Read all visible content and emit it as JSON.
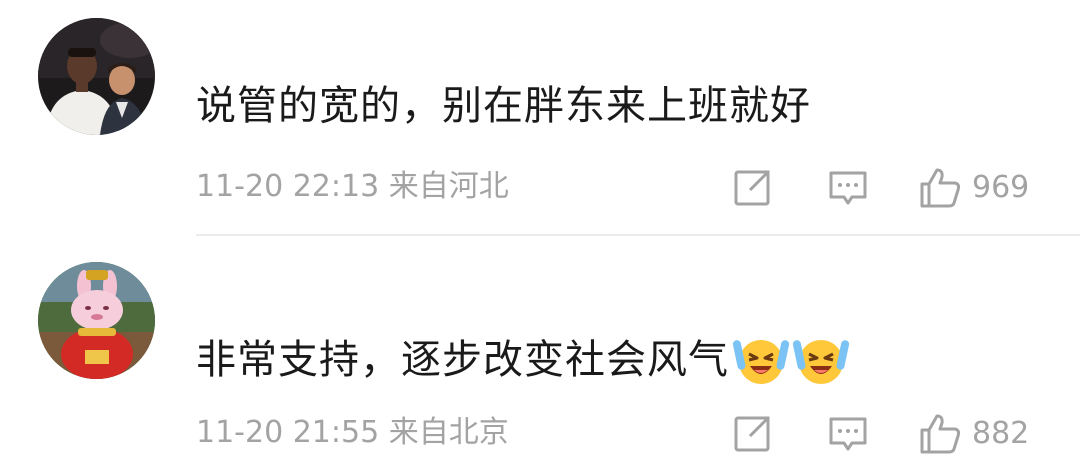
{
  "comments": [
    {
      "text": "说管的宽的，别在胖东来上班就好",
      "time": "11-20 22:13",
      "location": "来自河北",
      "likes": "969",
      "avatar_icon": "user-avatar-two-men"
    },
    {
      "text": "非常支持，逐步改变社会风气",
      "time": "11-20 21:55",
      "location": "来自北京",
      "likes": "882",
      "avatar_icon": "user-avatar-pink-rabbit",
      "emojis": [
        "laugh-cry-emoji",
        "laugh-cry-emoji"
      ]
    }
  ],
  "icons": {
    "share": "share-icon",
    "comment": "comment-icon",
    "like": "thumbs-up-icon"
  },
  "colors": {
    "text": "#1a1a1a",
    "meta": "#a3a3a3",
    "divider": "#ececec",
    "background": "#ffffff"
  }
}
